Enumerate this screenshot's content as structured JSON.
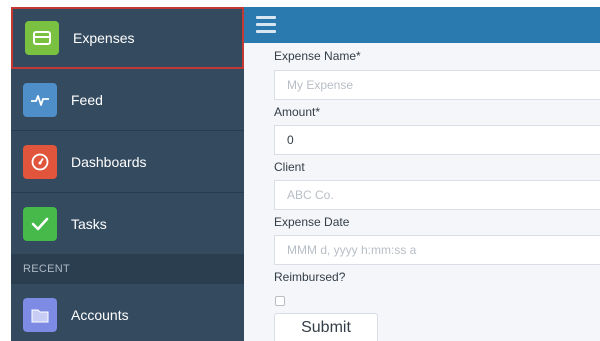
{
  "sidebar": {
    "items": [
      {
        "label": "Expenses",
        "icon": "credit-card-icon",
        "color": "#7ac142",
        "selected": true
      },
      {
        "label": "Feed",
        "icon": "pulse-icon",
        "color": "#4f8fc9"
      },
      {
        "label": "Dashboards",
        "icon": "gauge-icon",
        "color": "#e0553c"
      },
      {
        "label": "Tasks",
        "icon": "checkmark-icon",
        "color": "#46b94a"
      }
    ],
    "section_header": "RECENT",
    "recent_items": [
      {
        "label": "Accounts",
        "icon": "folder-icon",
        "color": "#7e8be4"
      }
    ]
  },
  "topbar": {
    "menu_icon": "hamburger-icon",
    "color": "#2a7ab0"
  },
  "form": {
    "expense_name": {
      "label": "Expense Name*",
      "placeholder": "My Expense"
    },
    "amount": {
      "label": "Amount*",
      "value": "0"
    },
    "client": {
      "label": "Client",
      "placeholder": "ABC Co."
    },
    "expense_date": {
      "label": "Expense Date",
      "placeholder": "MMM d, yyyy h:mm:ss a"
    },
    "reimbursed": {
      "label": "Reimbursed?",
      "checked": false
    },
    "submit_label": "Submit"
  },
  "colors": {
    "sidebar_bg": "#344a5f",
    "selected_outline": "#c23934",
    "main_bg": "#f4f6f9"
  }
}
